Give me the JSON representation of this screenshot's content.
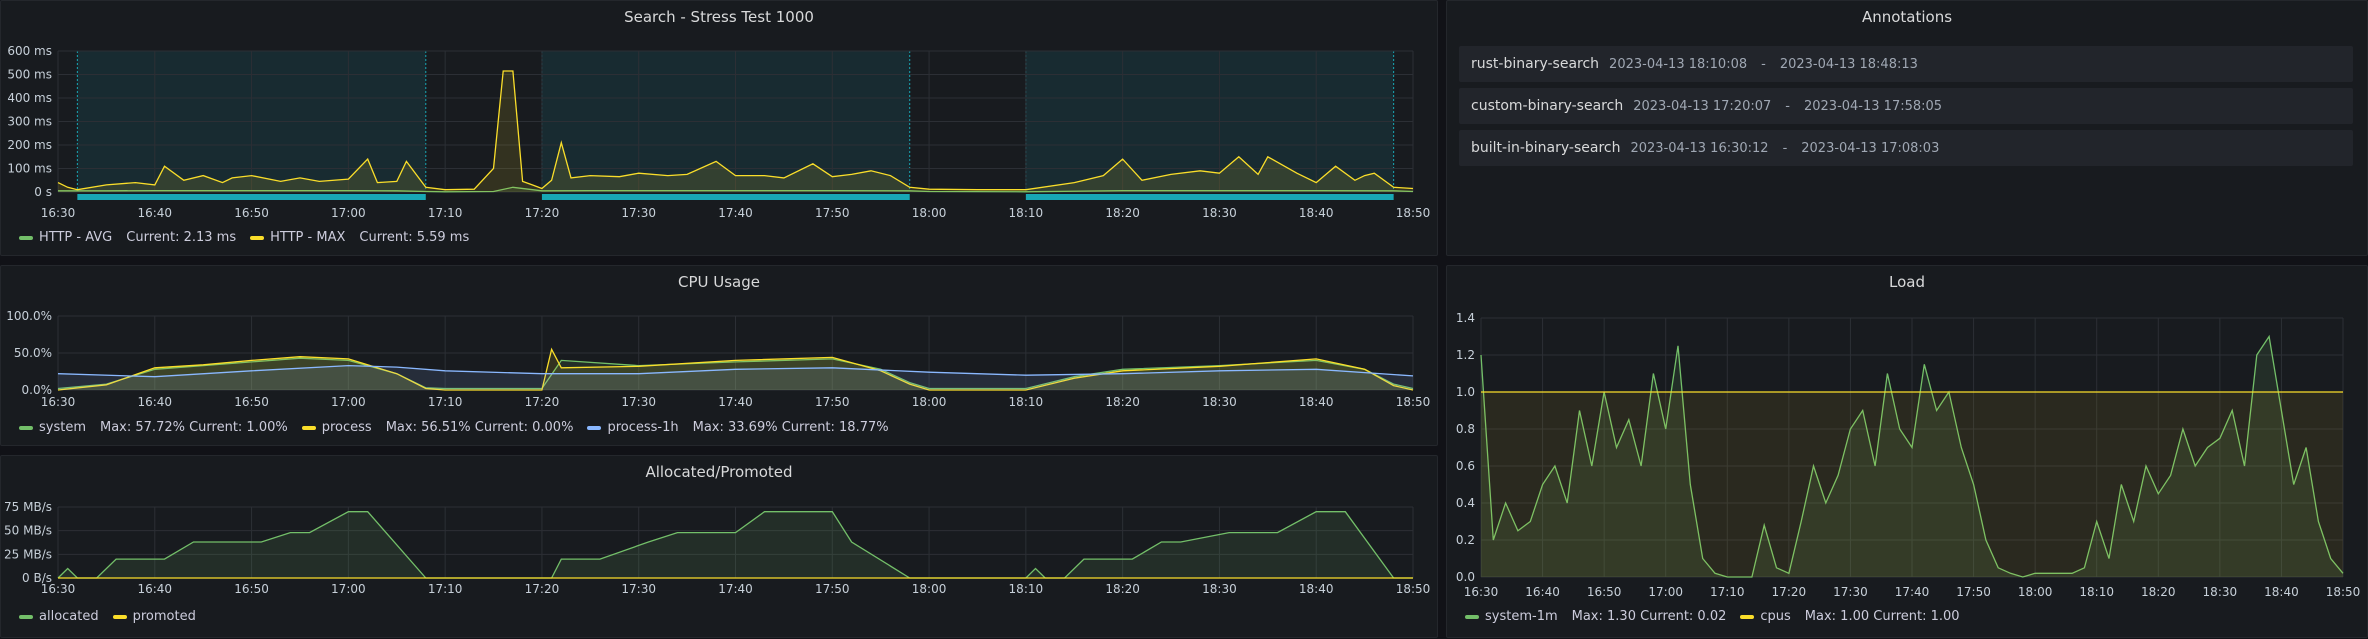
{
  "colors": {
    "green": "#73bf69",
    "yellow": "#fade2a",
    "blue": "#8ab8ff",
    "teal_band": "#18a7b5",
    "grid": "#2c2f35",
    "axis_text": "#c7d0d9"
  },
  "x_ticks": [
    "16:30",
    "16:40",
    "16:50",
    "17:00",
    "17:10",
    "17:20",
    "17:30",
    "17:40",
    "17:50",
    "18:00",
    "18:10",
    "18:20",
    "18:30",
    "18:40",
    "18:50"
  ],
  "panels": {
    "search": {
      "title": "Search - Stress Test 1000",
      "legend": [
        {
          "name": "HTTP - AVG",
          "stat": "Current: 2.13 ms",
          "color": "#73bf69"
        },
        {
          "name": "HTTP - MAX",
          "stat": "Current: 5.59 ms",
          "color": "#fade2a"
        }
      ]
    },
    "annotations": {
      "title": "Annotations",
      "items": [
        {
          "name": "rust-binary-search",
          "start": "2023-04-13 18:10:08",
          "sep": "-",
          "end": "2023-04-13 18:48:13"
        },
        {
          "name": "custom-binary-search",
          "start": "2023-04-13 17:20:07",
          "sep": "-",
          "end": "2023-04-13 17:58:05"
        },
        {
          "name": "built-in-binary-search",
          "start": "2023-04-13 16:30:12",
          "sep": "-",
          "end": "2023-04-13 17:08:03"
        }
      ]
    },
    "cpu": {
      "title": "CPU Usage",
      "legend": [
        {
          "name": "system",
          "stat": "Max: 57.72%  Current: 1.00%",
          "color": "#73bf69"
        },
        {
          "name": "process",
          "stat": "Max: 56.51%  Current: 0.00%",
          "color": "#fade2a"
        },
        {
          "name": "process-1h",
          "stat": "Max: 33.69%  Current: 18.77%",
          "color": "#8ab8ff"
        }
      ]
    },
    "alloc": {
      "title": "Allocated/Promoted",
      "legend": [
        {
          "name": "allocated",
          "stat": "",
          "color": "#73bf69"
        },
        {
          "name": "promoted",
          "stat": "",
          "color": "#fade2a"
        }
      ]
    },
    "load": {
      "title": "Load",
      "legend": [
        {
          "name": "system-1m",
          "stat": "Max: 1.30  Current: 0.02",
          "color": "#73bf69"
        },
        {
          "name": "cpus",
          "stat": "Max: 1.00  Current: 1.00",
          "color": "#fade2a"
        }
      ]
    }
  },
  "chart_data": [
    {
      "id": "search",
      "type": "line",
      "title": "Search - Stress Test 1000",
      "ylabel_ticks": [
        "0 s",
        "100 ms",
        "200 ms",
        "300 ms",
        "400 ms",
        "500 ms",
        "600 ms"
      ],
      "ylim": [
        0,
        600
      ],
      "xlim": [
        "16:30",
        "18:50"
      ],
      "annotation_regions": [
        [
          "16:32",
          "17:08"
        ],
        [
          "17:20",
          "17:58"
        ],
        [
          "18:10",
          "18:48"
        ]
      ],
      "series": [
        {
          "name": "HTTP - AVG",
          "x": [
            "16:30",
            "16:35",
            "16:40",
            "16:45",
            "16:50",
            "16:55",
            "17:00",
            "17:05",
            "17:08",
            "17:10",
            "17:15",
            "17:17",
            "17:20",
            "17:25",
            "17:30",
            "17:40",
            "17:50",
            "17:58",
            "18:00",
            "18:10",
            "18:20",
            "18:30",
            "18:40",
            "18:48",
            "18:50"
          ],
          "values": [
            5,
            5,
            6,
            6,
            6,
            6,
            6,
            5,
            2,
            1,
            2,
            20,
            5,
            6,
            6,
            6,
            6,
            5,
            2,
            1,
            6,
            6,
            6,
            5,
            2
          ]
        },
        {
          "name": "HTTP - MAX",
          "x": [
            "16:30",
            "16:31",
            "16:32",
            "16:35",
            "16:38",
            "16:40",
            "16:41",
            "16:43",
            "16:45",
            "16:47",
            "16:48",
            "16:50",
            "16:53",
            "16:55",
            "16:57",
            "17:00",
            "17:02",
            "17:03",
            "17:05",
            "17:06",
            "17:08",
            "17:10",
            "17:13",
            "17:15",
            "17:16",
            "17:17",
            "17:18",
            "17:19",
            "17:20",
            "17:21",
            "17:22",
            "17:23",
            "17:25",
            "17:28",
            "17:30",
            "17:33",
            "17:35",
            "17:38",
            "17:40",
            "17:43",
            "17:45",
            "17:48",
            "17:50",
            "17:52",
            "17:54",
            "17:56",
            "17:58",
            "18:00",
            "18:05",
            "18:10",
            "18:15",
            "18:18",
            "18:20",
            "18:22",
            "18:25",
            "18:28",
            "18:30",
            "18:32",
            "18:34",
            "18:35",
            "18:38",
            "18:40",
            "18:42",
            "18:44",
            "18:45",
            "18:46",
            "18:48",
            "18:50"
          ],
          "values": [
            40,
            20,
            10,
            30,
            40,
            30,
            110,
            50,
            70,
            40,
            60,
            70,
            45,
            60,
            45,
            55,
            140,
            40,
            45,
            130,
            20,
            10,
            12,
            100,
            515,
            515,
            45,
            30,
            15,
            50,
            210,
            60,
            70,
            65,
            80,
            70,
            75,
            130,
            70,
            70,
            60,
            120,
            65,
            75,
            90,
            70,
            20,
            12,
            10,
            10,
            40,
            70,
            140,
            50,
            75,
            90,
            80,
            150,
            75,
            150,
            80,
            40,
            110,
            50,
            70,
            80,
            20,
            15
          ]
        }
      ]
    },
    {
      "id": "cpu",
      "type": "line",
      "title": "CPU Usage",
      "ylabel_ticks": [
        "0.0%",
        "50.0%",
        "100.0%"
      ],
      "ylim": [
        0,
        100
      ],
      "xlim": [
        "16:30",
        "18:50"
      ],
      "series": [
        {
          "name": "system",
          "x": [
            "16:30",
            "16:35",
            "16:40",
            "16:45",
            "16:50",
            "16:55",
            "17:00",
            "17:05",
            "17:08",
            "17:10",
            "17:15",
            "17:20",
            "17:22",
            "17:30",
            "17:40",
            "17:50",
            "17:55",
            "17:58",
            "18:00",
            "18:10",
            "18:15",
            "18:20",
            "18:30",
            "18:40",
            "18:45",
            "18:48",
            "18:50"
          ],
          "values": [
            2,
            8,
            28,
            33,
            38,
            43,
            40,
            22,
            3,
            2,
            2,
            2,
            40,
            33,
            38,
            42,
            28,
            10,
            2,
            2,
            18,
            28,
            33,
            40,
            28,
            8,
            2
          ]
        },
        {
          "name": "process",
          "x": [
            "16:30",
            "16:35",
            "16:40",
            "16:45",
            "16:50",
            "16:55",
            "17:00",
            "17:05",
            "17:08",
            "17:10",
            "17:15",
            "17:20",
            "17:21",
            "17:22",
            "17:30",
            "17:40",
            "17:50",
            "17:55",
            "17:58",
            "18:00",
            "18:10",
            "18:15",
            "18:20",
            "18:30",
            "18:40",
            "18:45",
            "18:48",
            "18:50"
          ],
          "values": [
            0,
            7,
            30,
            34,
            40,
            45,
            42,
            22,
            2,
            0,
            0,
            0,
            55,
            30,
            32,
            40,
            44,
            26,
            8,
            0,
            0,
            16,
            26,
            32,
            42,
            28,
            6,
            0
          ]
        },
        {
          "name": "process-1h",
          "x": [
            "16:30",
            "16:40",
            "16:50",
            "17:00",
            "17:05",
            "17:10",
            "17:20",
            "17:30",
            "17:40",
            "17:50",
            "18:00",
            "18:10",
            "18:20",
            "18:30",
            "18:40",
            "18:50"
          ],
          "values": [
            22,
            18,
            26,
            33,
            31,
            26,
            22,
            22,
            28,
            30,
            24,
            20,
            22,
            26,
            28,
            19
          ]
        }
      ]
    },
    {
      "id": "alloc",
      "type": "area",
      "title": "Allocated/Promoted",
      "ylabel_ticks": [
        "0 B/s",
        "25 MB/s",
        "50 MB/s",
        "75 MB/s"
      ],
      "ylim": [
        0,
        75
      ],
      "xlim": [
        "16:30",
        "18:50"
      ],
      "series": [
        {
          "name": "allocated",
          "x": [
            "16:30",
            "16:31",
            "16:32",
            "16:34",
            "16:36",
            "16:41",
            "16:44",
            "16:46",
            "16:51",
            "16:54",
            "16:56",
            "17:00",
            "17:02",
            "17:08",
            "17:10",
            "17:20",
            "17:21",
            "17:22",
            "17:24",
            "17:26",
            "17:31",
            "17:34",
            "17:36",
            "17:40",
            "17:43",
            "17:45",
            "17:50",
            "17:52",
            "17:58",
            "18:00",
            "18:10",
            "18:11",
            "18:12",
            "18:14",
            "18:16",
            "18:21",
            "18:24",
            "18:26",
            "18:31",
            "18:34",
            "18:36",
            "18:40",
            "18:43",
            "18:48",
            "18:50"
          ],
          "values": [
            0,
            10,
            0,
            0,
            20,
            20,
            38,
            38,
            38,
            48,
            48,
            70,
            70,
            0,
            0,
            0,
            0,
            20,
            20,
            20,
            38,
            48,
            48,
            48,
            70,
            70,
            70,
            38,
            0,
            0,
            0,
            10,
            0,
            0,
            20,
            20,
            38,
            38,
            48,
            48,
            48,
            70,
            70,
            0,
            0
          ]
        },
        {
          "name": "promoted",
          "x": [
            "16:30",
            "18:50"
          ],
          "values": [
            0,
            0
          ]
        }
      ]
    },
    {
      "id": "load",
      "type": "line",
      "title": "Load",
      "ylabel_ticks": [
        "0.0",
        "0.2",
        "0.4",
        "0.6",
        "0.8",
        "1.0",
        "1.2",
        "1.4"
      ],
      "ylim": [
        0,
        1.4
      ],
      "xlim": [
        "16:30",
        "18:50"
      ],
      "series": [
        {
          "name": "system-1m",
          "x": [
            "16:30",
            "16:32",
            "16:34",
            "16:36",
            "16:38",
            "16:40",
            "16:42",
            "16:44",
            "16:46",
            "16:48",
            "16:50",
            "16:52",
            "16:54",
            "16:56",
            "16:58",
            "17:00",
            "17:02",
            "17:04",
            "17:06",
            "17:08",
            "17:10",
            "17:12",
            "17:14",
            "17:16",
            "17:18",
            "17:20",
            "17:22",
            "17:24",
            "17:26",
            "17:28",
            "17:30",
            "17:32",
            "17:34",
            "17:36",
            "17:38",
            "17:40",
            "17:42",
            "17:44",
            "17:46",
            "17:48",
            "17:50",
            "17:52",
            "17:54",
            "17:56",
            "17:58",
            "18:00",
            "18:02",
            "18:04",
            "18:06",
            "18:08",
            "18:10",
            "18:12",
            "18:14",
            "18:16",
            "18:18",
            "18:20",
            "18:22",
            "18:24",
            "18:26",
            "18:28",
            "18:30",
            "18:32",
            "18:34",
            "18:36",
            "18:38",
            "18:40",
            "18:42",
            "18:44",
            "18:46",
            "18:48",
            "18:50"
          ],
          "values": [
            1.2,
            0.2,
            0.4,
            0.25,
            0.3,
            0.5,
            0.6,
            0.4,
            0.9,
            0.6,
            1.0,
            0.7,
            0.85,
            0.6,
            1.1,
            0.8,
            1.25,
            0.5,
            0.1,
            0.02,
            0.0,
            0.0,
            0.0,
            0.28,
            0.05,
            0.02,
            0.3,
            0.6,
            0.4,
            0.55,
            0.8,
            0.9,
            0.6,
            1.1,
            0.8,
            0.7,
            1.15,
            0.9,
            1.0,
            0.7,
            0.5,
            0.2,
            0.05,
            0.02,
            0.0,
            0.02,
            0.02,
            0.02,
            0.02,
            0.05,
            0.3,
            0.1,
            0.5,
            0.3,
            0.6,
            0.45,
            0.55,
            0.8,
            0.6,
            0.7,
            0.75,
            0.9,
            0.6,
            1.2,
            1.3,
            0.9,
            0.5,
            0.7,
            0.3,
            0.1,
            0.02
          ]
        },
        {
          "name": "cpus",
          "x": [
            "16:30",
            "17:14",
            "17:15",
            "18:50"
          ],
          "values": [
            1.0,
            1.0,
            1.0,
            1.0
          ]
        }
      ]
    }
  ]
}
